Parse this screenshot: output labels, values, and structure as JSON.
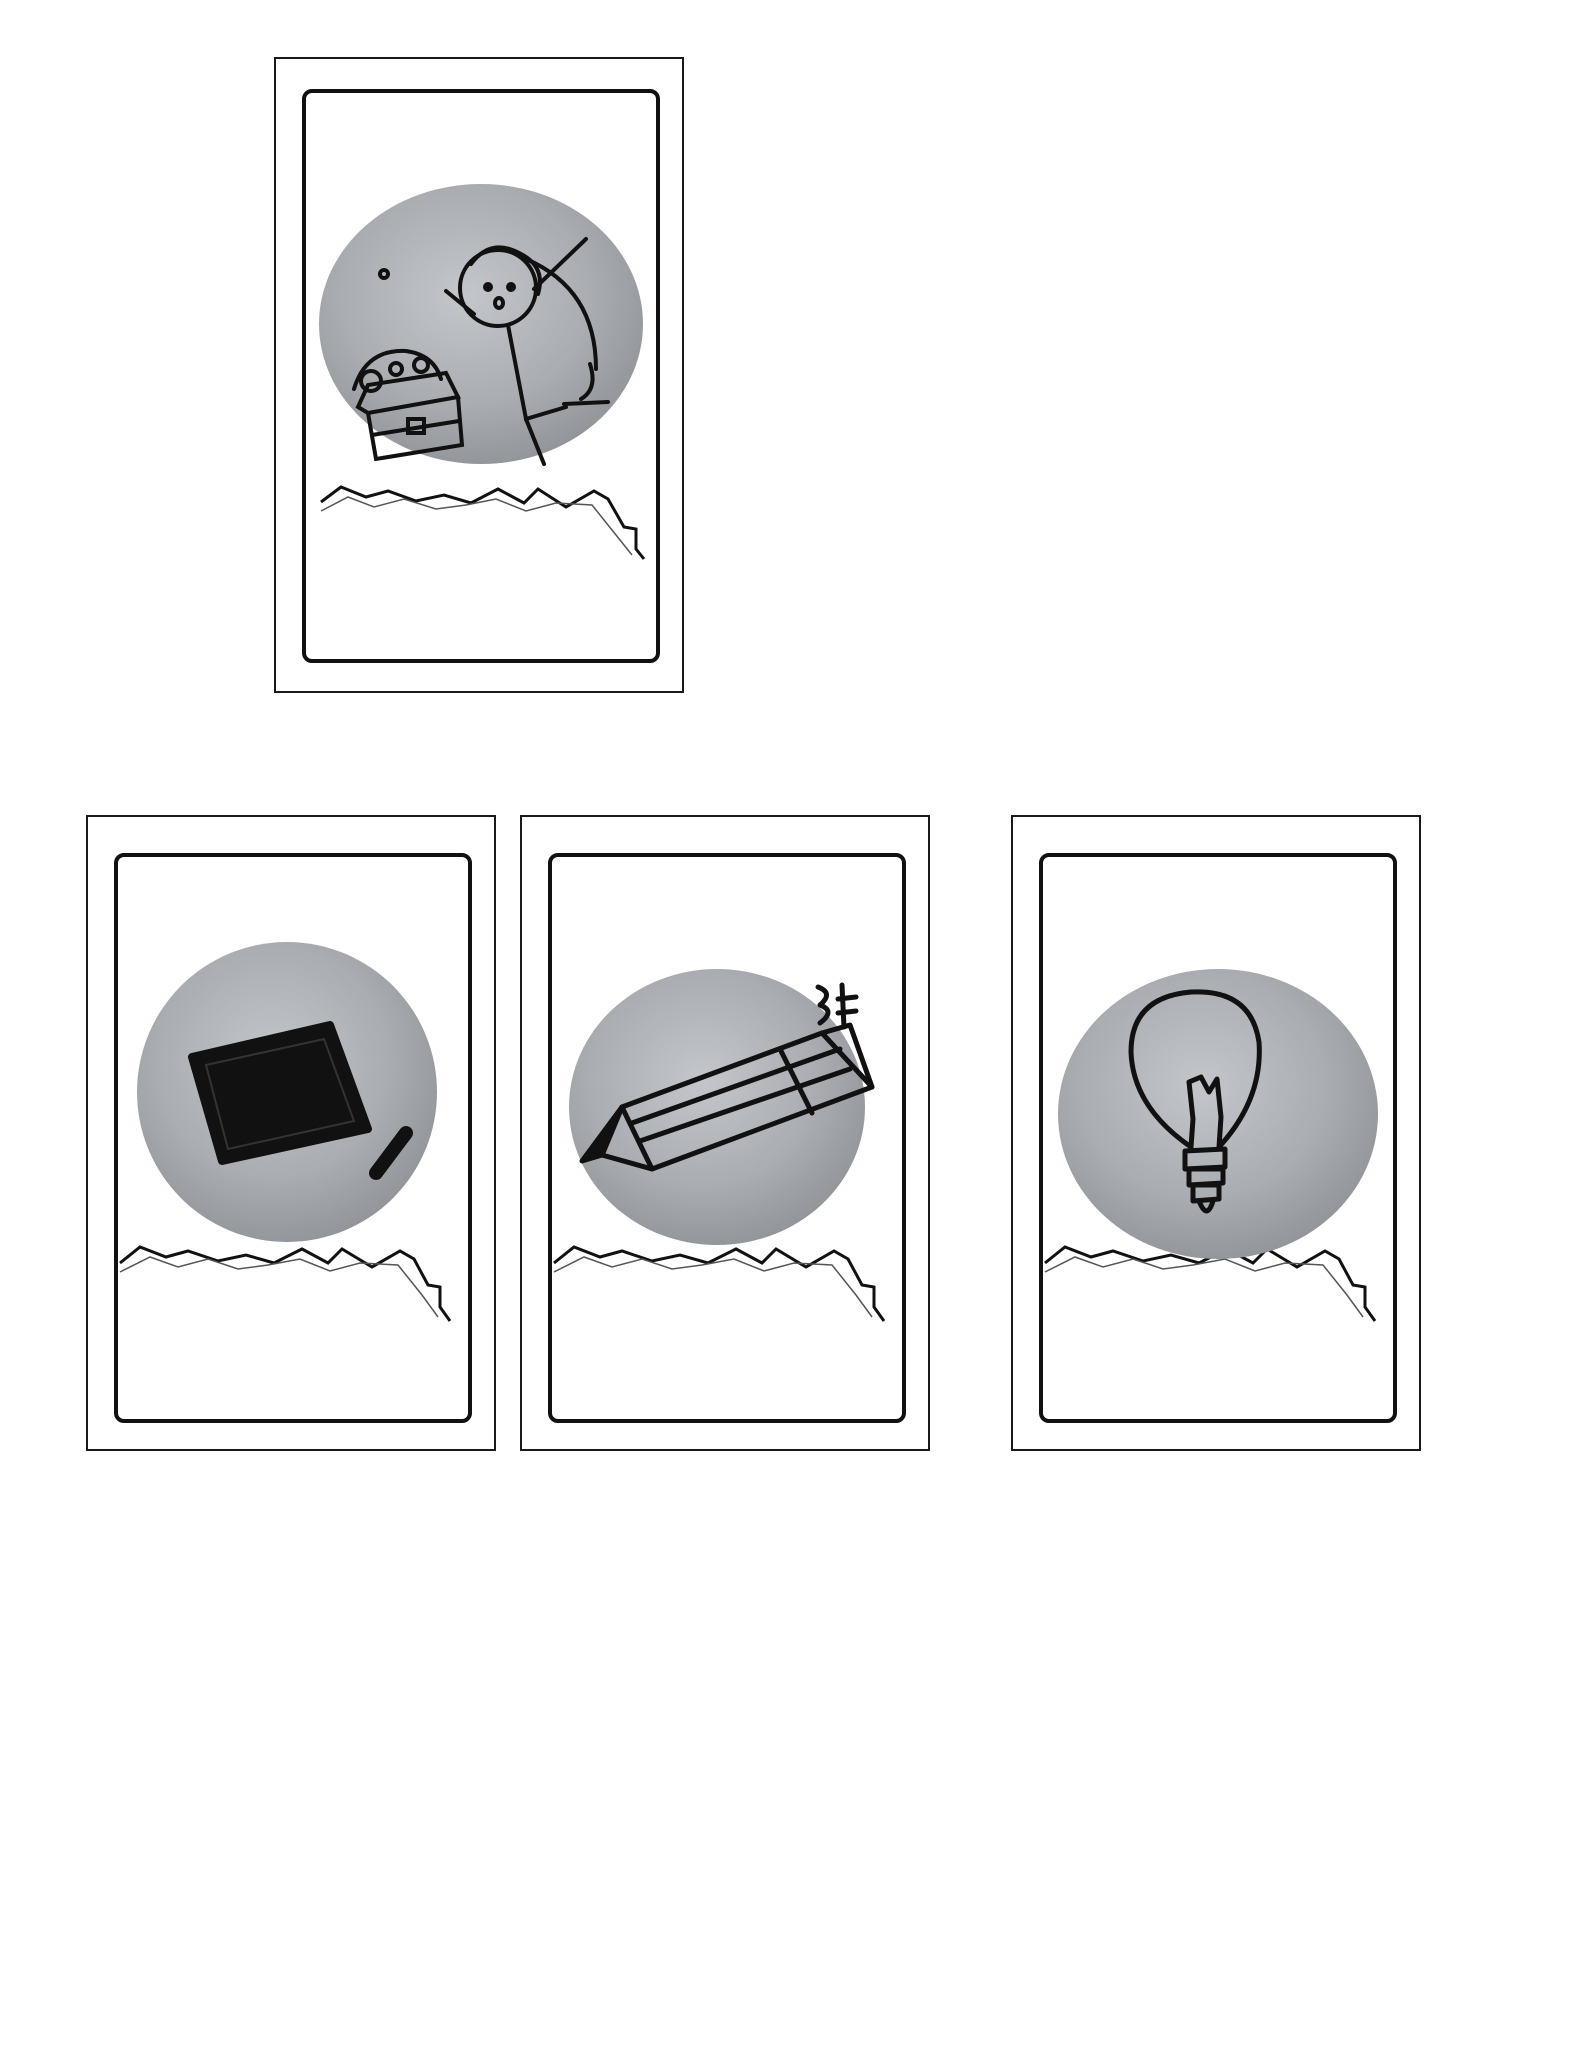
{
  "sheet": {
    "cards": [
      {
        "id": "card-1",
        "illustration": "stick-figure-with-treasure-chest-icon"
      },
      {
        "id": "card-2",
        "illustration": "chalkboard-with-chalk-icon"
      },
      {
        "id": "card-3",
        "illustration": "pencil-icon"
      },
      {
        "id": "card-4",
        "illustration": "light-bulb-icon"
      }
    ],
    "colors": {
      "background": "#ffffff",
      "ink": "#111111",
      "circle_fill": "#a9adb2",
      "circle_texture": "#8e9297"
    }
  }
}
